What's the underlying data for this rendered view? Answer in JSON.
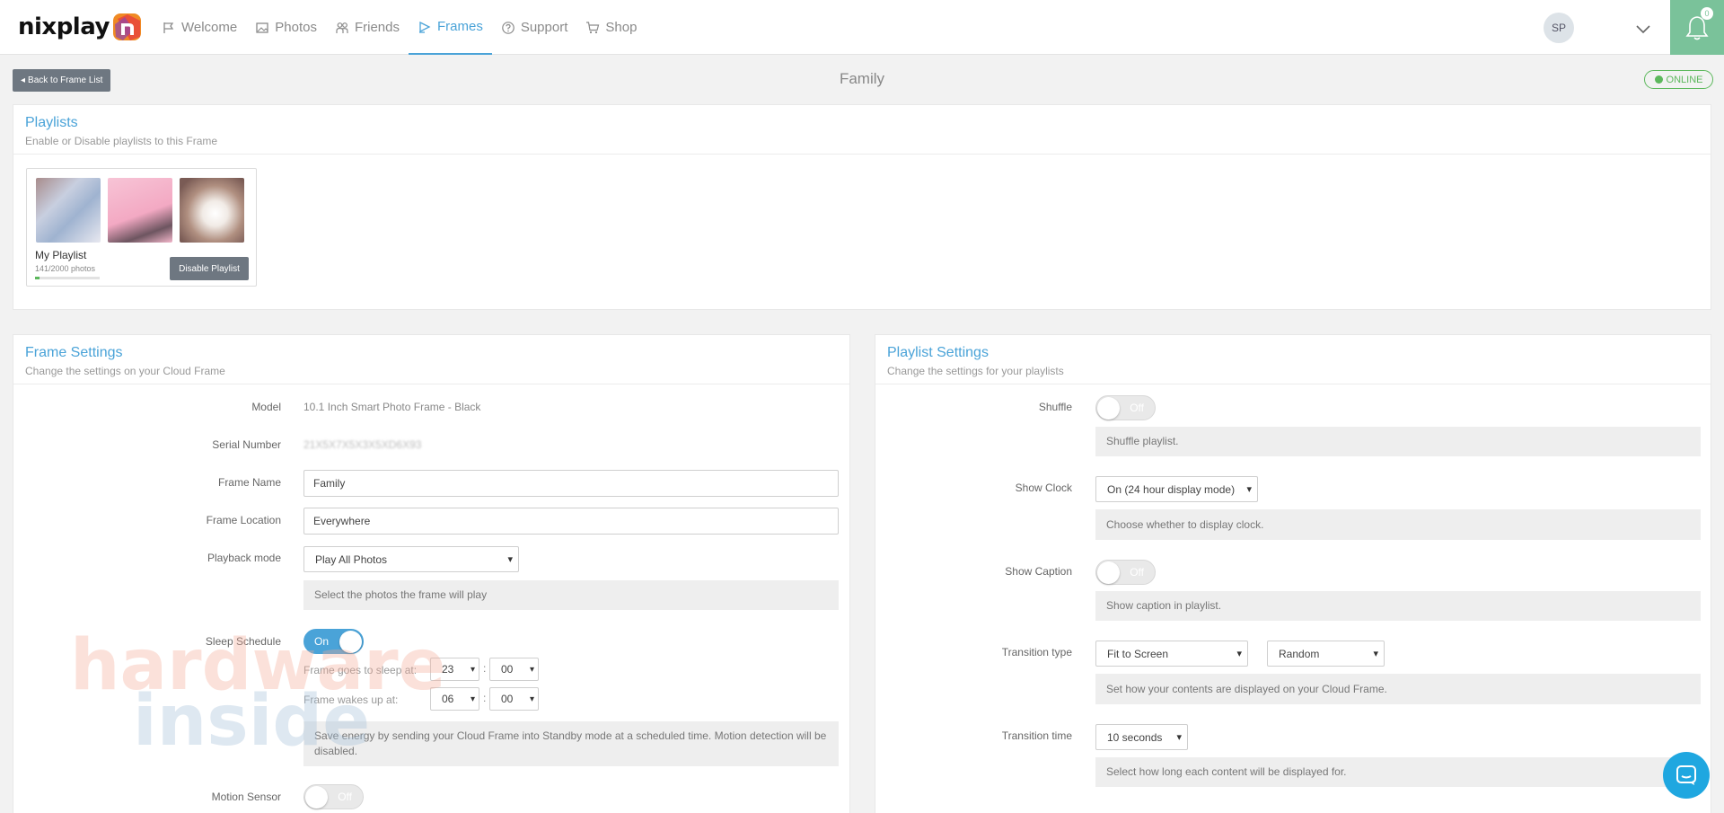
{
  "header": {
    "logo_text": "nixplay",
    "nav": [
      {
        "label": "Welcome",
        "icon": "flag-icon"
      },
      {
        "label": "Photos",
        "icon": "photos-icon"
      },
      {
        "label": "Friends",
        "icon": "friends-icon"
      },
      {
        "label": "Frames",
        "icon": "frames-icon",
        "active": true
      },
      {
        "label": "Support",
        "icon": "help-icon"
      },
      {
        "label": "Shop",
        "icon": "cart-icon"
      }
    ],
    "avatar_initials": "SP",
    "notification_count": "0"
  },
  "subheader": {
    "back_label": "Back to Frame List",
    "title": "Family",
    "status": "ONLINE"
  },
  "playlists_panel": {
    "title": "Playlists",
    "subtitle": "Enable or Disable playlists to this Frame",
    "card": {
      "name": "My Playlist",
      "count": "141/2000 photos",
      "progress_fraction": 0.07,
      "button": "Disable Playlist"
    }
  },
  "frame_settings": {
    "title": "Frame Settings",
    "subtitle": "Change the settings on your Cloud Frame",
    "model_label": "Model",
    "model_value": "10.1 Inch Smart Photo Frame - Black",
    "serial_label": "Serial Number",
    "serial_value": "21X5X7X5X3X5XD6X93",
    "name_label": "Frame Name",
    "name_value": "Family",
    "location_label": "Frame Location",
    "location_value": "Everywhere",
    "playback_label": "Playback mode",
    "playback_value": "Play All Photos",
    "playback_help": "Select the photos the frame will play",
    "sleep_label": "Sleep Schedule",
    "sleep_toggle": "On",
    "sleep_at_label": "Frame goes to sleep at:",
    "sleep_hour": "23",
    "sleep_min": "00",
    "wake_label": "Frame wakes up at:",
    "wake_hour": "06",
    "wake_min": "00",
    "time_sep": ":",
    "sleep_help": "Save energy by sending your Cloud Frame into Standby mode at a scheduled time. Motion detection will be disabled.",
    "motion_label": "Motion Sensor",
    "motion_toggle": "Off"
  },
  "playlist_settings": {
    "title": "Playlist Settings",
    "subtitle": "Change the settings for your playlists",
    "shuffle_label": "Shuffle",
    "shuffle_toggle": "Off",
    "shuffle_help": "Shuffle playlist.",
    "clock_label": "Show Clock",
    "clock_value": "On (24 hour display mode)",
    "clock_help": "Choose whether to display clock.",
    "caption_label": "Show Caption",
    "caption_toggle": "Off",
    "caption_help": "Show caption in playlist.",
    "transition_type_label": "Transition type",
    "transition_fit": "Fit to Screen",
    "transition_effect": "Random",
    "transition_help": "Set how your contents are displayed on your Cloud Frame.",
    "transition_time_label": "Transition time",
    "transition_time_value": "10 seconds",
    "transition_time_help": "Select how long each content will be displayed for."
  },
  "watermark": {
    "line1": "hardware",
    "line2": "inside"
  },
  "colors": {
    "accent": "#4aa3d8",
    "online": "#5cb85c",
    "bell": "#7ac29a",
    "button": "#6e7781"
  }
}
